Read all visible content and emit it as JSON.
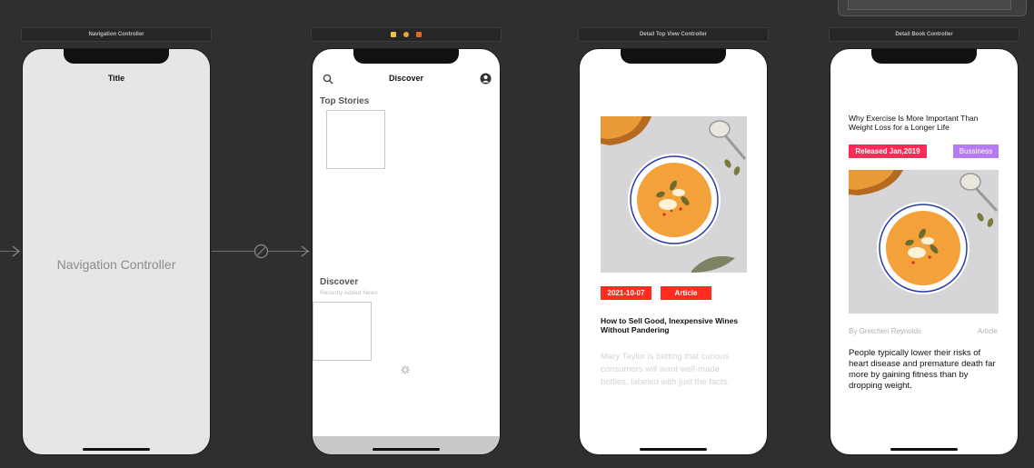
{
  "scenes": {
    "nav_controller": {
      "bar_title": "Navigation Controller",
      "nav_title": "Title",
      "center_label": "Navigation Controller"
    },
    "discover": {
      "nav_title": "Discover",
      "search_icon": "search-icon",
      "profile_icon": "person-circle-icon",
      "top_stories_label": "Top Stories",
      "discover_label": "Discover",
      "discover_sublabel": "Recently Added News",
      "spinner_icon": "activity-indicator-icon"
    },
    "detail_top": {
      "bar_title": "Detail Top View Controller",
      "image_icon": "soup-bowl-image",
      "date_tag": "2021-10-07",
      "type_tag": "Article",
      "headline": "How to Sell Good, Inexpensive Wines Without Pandering",
      "summary": "Mary Taylor is betting that curious consumers will want well-made bottles, labeled with just the facts."
    },
    "detail_book": {
      "bar_title": "Detail Book Controller",
      "headline": "Why Exercise Is More Important Than Weight Loss for a Longer Life",
      "released_tag": "Released Jan,2019",
      "category_tag": "Bussiness",
      "image_icon": "soup-bowl-image",
      "author": "By Gretchen Reynolds",
      "type": "Article",
      "body": "People typically lower their risks of heart disease and premature death far more by gaining fitness than by dropping weight."
    }
  },
  "colors": {
    "canvas": "#2f2f2f",
    "tag_red": "#ff2d21",
    "tag_pink": "#ff2a58",
    "tag_purple": "#b57bf0",
    "soup_orange": "#f3a13a"
  }
}
